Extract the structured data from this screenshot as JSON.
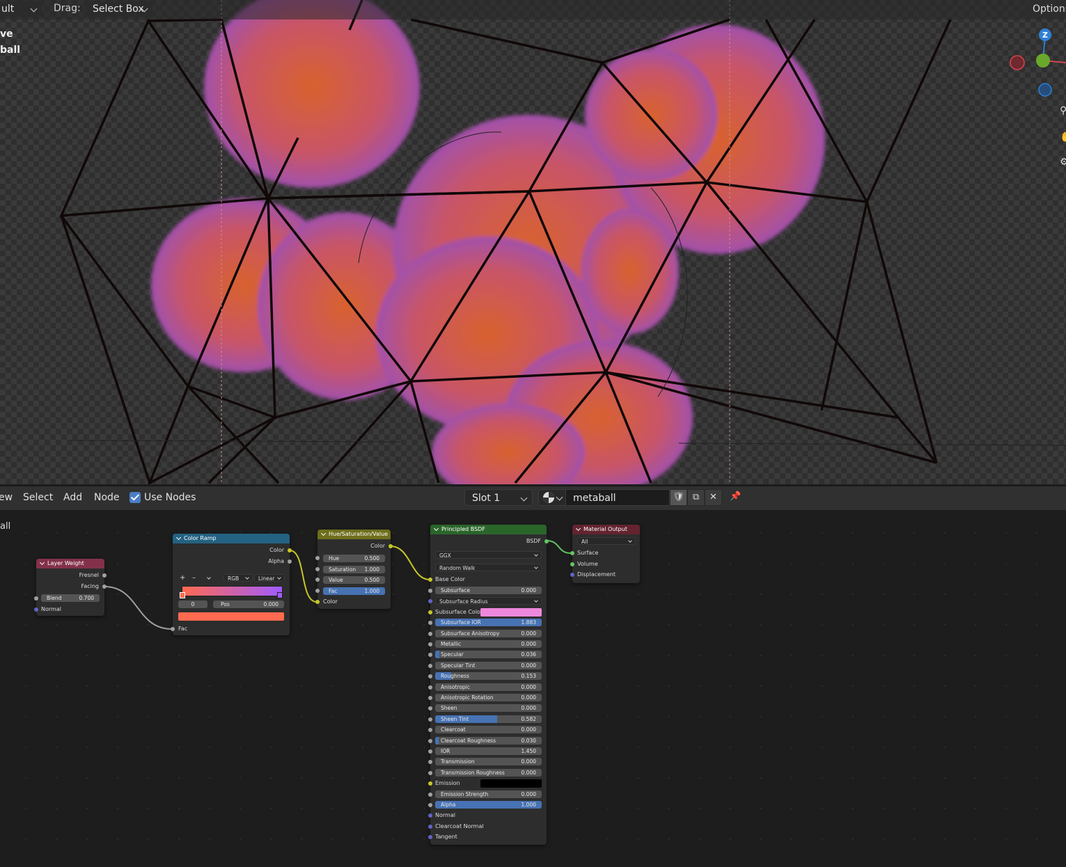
{
  "viewport_header": {
    "mode_fragment": "ult",
    "drag_label": "Drag:",
    "drag_value": "Select Box",
    "options_label": "Options"
  },
  "viewport_overlay": {
    "line1": "ve",
    "line2": "ball"
  },
  "gizmo": {
    "z_label": "Z"
  },
  "node_editor": {
    "menu": {
      "view": "ew",
      "select": "Select",
      "add": "Add",
      "node": "Node"
    },
    "use_nodes_label": "Use Nodes",
    "slot": "Slot 1",
    "material_name": "metaball",
    "left_label": "all"
  },
  "nodes": {
    "layer_weight": {
      "title": "Layer Weight",
      "fresnel": "Fresnel",
      "facing": "Facing",
      "blend_label": "Blend",
      "blend_value": "0.700",
      "normal": "Normal"
    },
    "color_ramp": {
      "title": "Color Ramp",
      "out_color": "Color",
      "out_alpha": "Alpha",
      "add": "+",
      "remove": "–",
      "mode": "RGB",
      "interp": "Linear",
      "index": "0",
      "pos_label": "Pos",
      "pos_value": "0.000",
      "fac": "Fac"
    },
    "hsv": {
      "title": "Hue/Saturation/Value",
      "out_color": "Color",
      "hue_label": "Hue",
      "hue_value": "0.500",
      "sat_label": "Saturation",
      "sat_value": "1.000",
      "val_label": "Value",
      "val_value": "0.500",
      "fac_label": "Fac",
      "fac_value": "1.000",
      "in_color": "Color"
    },
    "bsdf": {
      "title": "Principled BSDF",
      "out": "BSDF",
      "distribution": "GGX",
      "subsurface_method": "Random Walk",
      "base_color": "Base Color",
      "subsurface_radius": "Subsurface Radius",
      "subsurface_color": "Subsurface Color",
      "emission": "Emission",
      "normal": "Normal",
      "clearcoat_normal": "Clearcoat Normal",
      "tangent": "Tangent",
      "fields": [
        {
          "label": "Subsurface",
          "value": "0.000",
          "fill": 0.0
        },
        {
          "label": "Subsurface IOR",
          "value": "1.883",
          "fill": 1.0
        },
        {
          "label": "Subsurface Anisotropy",
          "value": "0.000",
          "fill": 0.0
        },
        {
          "label": "Metallic",
          "value": "0.000",
          "fill": 0.0
        },
        {
          "label": "Specular",
          "value": "0.036",
          "fill": 0.036
        },
        {
          "label": "Specular Tint",
          "value": "0.000",
          "fill": 0.0
        },
        {
          "label": "Roughness",
          "value": "0.153",
          "fill": 0.153
        },
        {
          "label": "Anisotropic",
          "value": "0.000",
          "fill": 0.0
        },
        {
          "label": "Anisotropic Rotation",
          "value": "0.000",
          "fill": 0.0
        },
        {
          "label": "Sheen",
          "value": "0.000",
          "fill": 0.0
        },
        {
          "label": "Sheen Tint",
          "value": "0.582",
          "fill": 0.582
        },
        {
          "label": "Clearcoat",
          "value": "0.000",
          "fill": 0.0
        },
        {
          "label": "Clearcoat Roughness",
          "value": "0.030",
          "fill": 0.03
        },
        {
          "label": "IOR",
          "value": "1.450",
          "fill": 0.0
        },
        {
          "label": "Transmission",
          "value": "0.000",
          "fill": 0.0
        },
        {
          "label": "Transmission Roughness",
          "value": "0.000",
          "fill": 0.0
        },
        {
          "label": "Emission Strength",
          "value": "0.000",
          "fill": 0.0
        },
        {
          "label": "Alpha",
          "value": "1.000",
          "fill": 1.0
        }
      ]
    },
    "output": {
      "title": "Material Output",
      "target": "All",
      "surface": "Surface",
      "volume": "Volume",
      "displacement": "Displacement"
    }
  },
  "colors": {
    "layer_weight_header": "#83314a",
    "color_ramp_header": "#246283",
    "hsv_header": "#6e6e1d",
    "bsdf_header": "#2a652a",
    "output_header": "#632430",
    "subsurface_color": "#ee88dd",
    "emission_color": "#000000",
    "ramp_swatch": "#ff6a50"
  }
}
